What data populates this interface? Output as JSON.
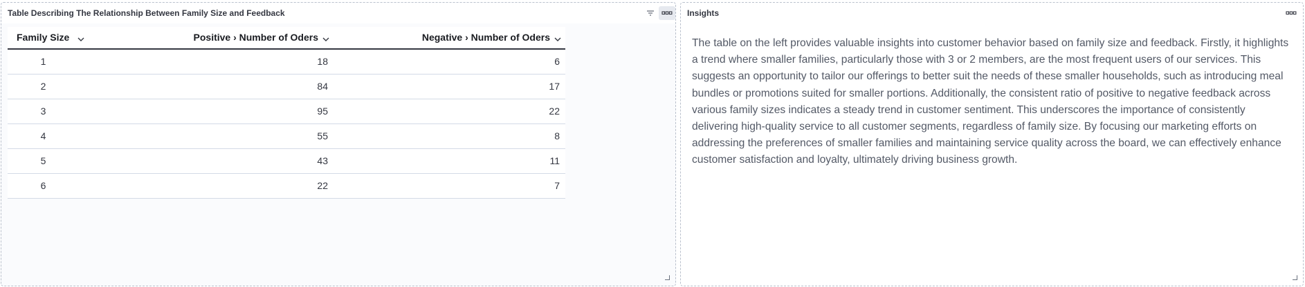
{
  "table_panel": {
    "title": "Table Describing The Relationship Between Family Size and Feedback",
    "columns": {
      "family_size": "Family Size",
      "positive": "Positive › Number of Oders",
      "negative": "Negative › Number of Oders"
    },
    "rows": [
      {
        "family_size": "1",
        "positive": "18",
        "negative": "6"
      },
      {
        "family_size": "2",
        "positive": "84",
        "negative": "17"
      },
      {
        "family_size": "3",
        "positive": "95",
        "negative": "22"
      },
      {
        "family_size": "4",
        "positive": "55",
        "negative": "8"
      },
      {
        "family_size": "5",
        "positive": "43",
        "negative": "11"
      },
      {
        "family_size": "6",
        "positive": "22",
        "negative": "7"
      }
    ],
    "icons": [
      "filter-icon",
      "panel-options-icon",
      "resize-handle-icon"
    ]
  },
  "insights_panel": {
    "title": "Insights",
    "text": "The table on the left provides valuable insights into customer behavior based on family size and feedback. Firstly, it highlights a trend where smaller families, particularly those with 3 or 2 members, are the most frequent users of our services. This suggests an opportunity to tailor our offerings to better suit the needs of these smaller households, such as introducing meal bundles or promotions suited for smaller portions. Additionally, the consistent ratio of positive to negative feedback across various family sizes indicates a steady trend in customer sentiment. This underscores the importance of consistently delivering high-quality service to all customer segments, regardless of family size. By focusing our marketing efforts on addressing the preferences of smaller families and maintaining service quality across the board, we can effectively enhance customer satisfaction and loyalty, ultimately driving business growth.",
    "icons": [
      "panel-options-icon",
      "resize-handle-icon"
    ]
  },
  "colors": {
    "panel_border": "#b9c0cc",
    "header_text": "#1a1c21",
    "body_text": "#535966",
    "row_border": "#d3dae6"
  }
}
